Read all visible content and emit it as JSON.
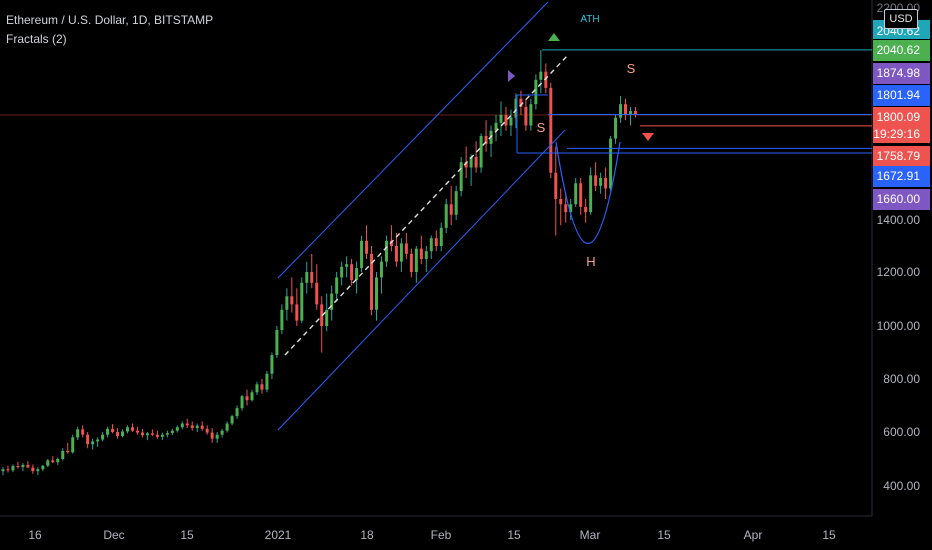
{
  "header": {
    "title": "Ethereum / U.S. Dollar, 1D, BITSTAMP",
    "indicator": "Fractals (2)",
    "currency": "USD"
  },
  "chart_data": {
    "type": "candlestick",
    "title": "Ethereum / U.S. Dollar, 1D, BITSTAMP",
    "y_axis": {
      "ticks": [
        "400.00",
        "600.00",
        "800.00",
        "1000.00",
        "1200.00",
        "1400.00"
      ],
      "tick_values": [
        400,
        600,
        800,
        1000,
        1200,
        1400
      ]
    },
    "x_axis": {
      "ticks": [
        "16",
        "Dec",
        "15",
        "2021",
        "18",
        "Feb",
        "15",
        "Mar",
        "15",
        "Apr",
        "15"
      ]
    },
    "price_labels": [
      {
        "text": "2200.00",
        "value": 2200,
        "color": "#555a66",
        "partial": true
      },
      {
        "text": "2040.62",
        "value": 2040.62,
        "color": "#1fa7b8",
        "dup": true
      },
      {
        "text": "2040.62",
        "value": 2040.62,
        "color": "#4caf50"
      },
      {
        "text": "1874.98",
        "value": 1874.98,
        "color": "#7e57c2"
      },
      {
        "text": "1801.94",
        "value": 1801.94,
        "color": "#2962ff"
      },
      {
        "text": "1800.09",
        "value": 1800.09,
        "color": "#ef5350",
        "sub": "19:29:16"
      },
      {
        "text": "1758.79",
        "value": 1758.79,
        "color": "#ef5350"
      },
      {
        "text": "1672.91",
        "value": 1672.91,
        "color": "#2962ff"
      },
      {
        "text": "1660.00",
        "value": 1660,
        "color": "#7e57c2"
      }
    ],
    "annotations": [
      "ATH",
      "S",
      "S",
      "H"
    ],
    "candles": [
      [
        455,
        470,
        440,
        462
      ],
      [
        462,
        475,
        450,
        458
      ],
      [
        458,
        480,
        452,
        474
      ],
      [
        474,
        490,
        465,
        470
      ],
      [
        470,
        485,
        455,
        478
      ],
      [
        478,
        492,
        470,
        468
      ],
      [
        468,
        480,
        445,
        455
      ],
      [
        455,
        470,
        440,
        462
      ],
      [
        462,
        478,
        455,
        475
      ],
      [
        475,
        500,
        470,
        495
      ],
      [
        495,
        510,
        485,
        488
      ],
      [
        488,
        505,
        478,
        500
      ],
      [
        500,
        540,
        495,
        530
      ],
      [
        530,
        560,
        520,
        525
      ],
      [
        525,
        590,
        520,
        580
      ],
      [
        580,
        620,
        570,
        610
      ],
      [
        610,
        625,
        580,
        590
      ],
      [
        590,
        600,
        540,
        555
      ],
      [
        555,
        575,
        535,
        565
      ],
      [
        565,
        580,
        545,
        572
      ],
      [
        572,
        600,
        565,
        590
      ],
      [
        590,
        620,
        580,
        612
      ],
      [
        612,
        630,
        595,
        600
      ],
      [
        600,
        615,
        575,
        585
      ],
      [
        585,
        610,
        580,
        602
      ],
      [
        602,
        625,
        595,
        618
      ],
      [
        618,
        632,
        600,
        605
      ],
      [
        605,
        620,
        590,
        598
      ],
      [
        598,
        612,
        580,
        588
      ],
      [
        588,
        600,
        570,
        595
      ],
      [
        595,
        610,
        585,
        590
      ],
      [
        590,
        605,
        575,
        582
      ],
      [
        582,
        598,
        570,
        590
      ],
      [
        590,
        605,
        580,
        596
      ],
      [
        596,
        612,
        588,
        605
      ],
      [
        605,
        625,
        598,
        618
      ],
      [
        618,
        640,
        610,
        632
      ],
      [
        632,
        650,
        615,
        625
      ],
      [
        625,
        640,
        605,
        615
      ],
      [
        615,
        632,
        600,
        624
      ],
      [
        624,
        640,
        605,
        612
      ],
      [
        612,
        625,
        590,
        598
      ],
      [
        598,
        615,
        560,
        575
      ],
      [
        575,
        600,
        560,
        590
      ],
      [
        590,
        612,
        580,
        605
      ],
      [
        605,
        640,
        598,
        632
      ],
      [
        632,
        665,
        625,
        660
      ],
      [
        660,
        700,
        650,
        690
      ],
      [
        690,
        740,
        680,
        735
      ],
      [
        735,
        760,
        700,
        720
      ],
      [
        720,
        760,
        715,
        750
      ],
      [
        750,
        790,
        740,
        780
      ],
      [
        780,
        800,
        745,
        760
      ],
      [
        760,
        830,
        750,
        820
      ],
      [
        820,
        900,
        800,
        890
      ],
      [
        890,
        1000,
        880,
        985
      ],
      [
        985,
        1080,
        970,
        1060
      ],
      [
        1060,
        1140,
        1020,
        1110
      ],
      [
        1110,
        1180,
        1050,
        1080
      ],
      [
        1080,
        1140,
        1000,
        1020
      ],
      [
        1020,
        1180,
        1010,
        1160
      ],
      [
        1160,
        1240,
        1120,
        1200
      ],
      [
        1200,
        1270,
        1140,
        1160
      ],
      [
        1160,
        1230,
        1060,
        1080
      ],
      [
        1080,
        1110,
        900,
        1000
      ],
      [
        1000,
        1120,
        980,
        1060
      ],
      [
        1060,
        1150,
        1020,
        1120
      ],
      [
        1120,
        1200,
        1090,
        1180
      ],
      [
        1180,
        1240,
        1150,
        1220
      ],
      [
        1220,
        1260,
        1180,
        1230
      ],
      [
        1230,
        1250,
        1150,
        1170
      ],
      [
        1170,
        1240,
        1120,
        1215
      ],
      [
        1215,
        1340,
        1200,
        1320
      ],
      [
        1320,
        1380,
        1250,
        1270
      ],
      [
        1270,
        1300,
        1040,
        1060
      ],
      [
        1060,
        1200,
        1020,
        1180
      ],
      [
        1180,
        1260,
        1120,
        1240
      ],
      [
        1240,
        1340,
        1220,
        1320
      ],
      [
        1320,
        1380,
        1280,
        1300
      ],
      [
        1300,
        1350,
        1220,
        1240
      ],
      [
        1240,
        1330,
        1200,
        1310
      ],
      [
        1310,
        1350,
        1250,
        1270
      ],
      [
        1270,
        1290,
        1180,
        1200
      ],
      [
        1200,
        1300,
        1160,
        1290
      ],
      [
        1290,
        1340,
        1230,
        1250
      ],
      [
        1250,
        1300,
        1200,
        1280
      ],
      [
        1280,
        1340,
        1250,
        1330
      ],
      [
        1330,
        1360,
        1280,
        1300
      ],
      [
        1300,
        1390,
        1280,
        1370
      ],
      [
        1370,
        1480,
        1350,
        1460
      ],
      [
        1460,
        1530,
        1380,
        1420
      ],
      [
        1420,
        1530,
        1400,
        1510
      ],
      [
        1510,
        1640,
        1490,
        1620
      ],
      [
        1620,
        1680,
        1560,
        1600
      ],
      [
        1600,
        1650,
        1530,
        1640
      ],
      [
        1640,
        1700,
        1580,
        1600
      ],
      [
        1600,
        1730,
        1580,
        1720
      ],
      [
        1720,
        1780,
        1660,
        1690
      ],
      [
        1690,
        1760,
        1640,
        1740
      ],
      [
        1740,
        1800,
        1700,
        1770
      ],
      [
        1770,
        1850,
        1720,
        1800
      ],
      [
        1800,
        1830,
        1740,
        1760
      ],
      [
        1760,
        1820,
        1720,
        1790
      ],
      [
        1790,
        1880,
        1750,
        1860
      ],
      [
        1860,
        1890,
        1800,
        1830
      ],
      [
        1830,
        1860,
        1740,
        1760
      ],
      [
        1760,
        1860,
        1740,
        1840
      ],
      [
        1840,
        1950,
        1820,
        1930
      ],
      [
        1930,
        2040,
        1880,
        1960
      ],
      [
        1960,
        1990,
        1880,
        1900
      ],
      [
        1900,
        1920,
        1560,
        1580
      ],
      [
        1580,
        1680,
        1340,
        1480
      ],
      [
        1480,
        1520,
        1380,
        1460
      ],
      [
        1460,
        1500,
        1390,
        1430
      ],
      [
        1430,
        1480,
        1400,
        1460
      ],
      [
        1460,
        1560,
        1450,
        1540
      ],
      [
        1540,
        1560,
        1420,
        1450
      ],
      [
        1450,
        1480,
        1390,
        1430
      ],
      [
        1430,
        1600,
        1420,
        1570
      ],
      [
        1570,
        1620,
        1510,
        1530
      ],
      [
        1530,
        1580,
        1500,
        1560
      ],
      [
        1560,
        1600,
        1480,
        1520
      ],
      [
        1520,
        1720,
        1510,
        1710
      ],
      [
        1710,
        1800,
        1690,
        1790
      ],
      [
        1790,
        1870,
        1770,
        1840
      ],
      [
        1840,
        1860,
        1780,
        1800
      ],
      [
        1800,
        1830,
        1760,
        1815
      ],
      [
        1815,
        1830,
        1790,
        1800
      ]
    ]
  }
}
